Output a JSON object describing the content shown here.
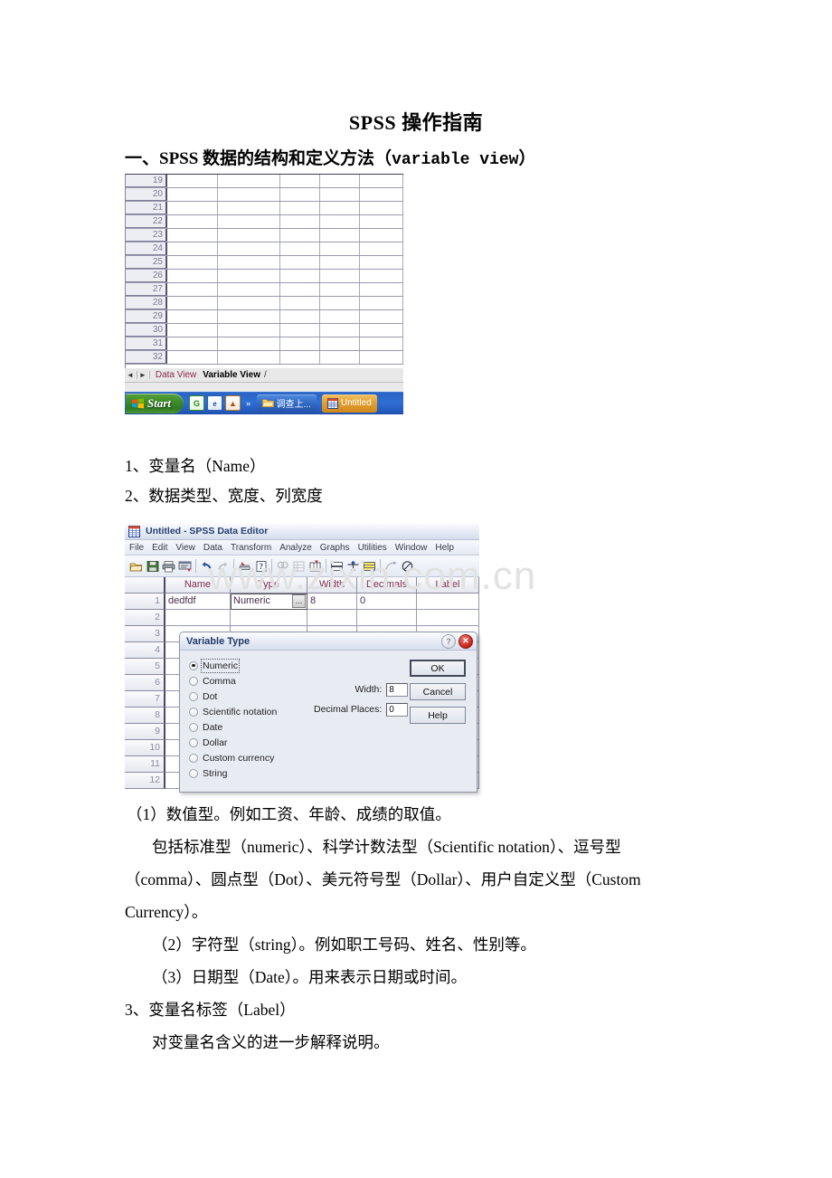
{
  "document": {
    "title": "SPSS 操作指南",
    "heading1_prefix": "一、SPSS 数据的结构和定义方法（",
    "heading1_mono": "variable view",
    "heading1_suffix": "）",
    "item1": "1、变量名（Name）",
    "item2": "2、数据类型、宽度、列宽度",
    "p1": "（1）数值型。例如工资、年龄、成绩的取值。",
    "p2": "包括标准型（numeric）、科学计数法型（Scientific notation）、逗号型",
    "p3": "（comma）、圆点型（Dot）、美元符号型（Dollar）、用户自定义型（Custom",
    "p4": "Currency）。",
    "p5": "（2）字符型（string）。例如职工号码、姓名、性别等。",
    "p6": "（3）日期型（Date）。用来表示日期或时间。",
    "p7": "3、变量名标签（Label）",
    "p8": "对变量名含义的进一步解释说明。",
    "watermark": "www.zixin.com.cn"
  },
  "screenshot1": {
    "row_numbers": [
      "19",
      "20",
      "21",
      "22",
      "23",
      "24",
      "25",
      "26",
      "27",
      "28",
      "29",
      "30",
      "31",
      "32"
    ],
    "tabs": {
      "back_arrow": "◄",
      "forward_arrow": "►",
      "data_view": "Data View",
      "variable_view": "Variable View",
      "trailing_slash": "/"
    },
    "taskbar": {
      "start_label": "Start",
      "overflow_chevron": "»",
      "items": [
        {
          "label": "调查上...",
          "icon": "folder-icon"
        },
        {
          "label": "Untitled",
          "icon": "spss-icon"
        }
      ],
      "quick_launch": [
        {
          "icon": "green-g-icon",
          "letter": "G"
        },
        {
          "icon": "blue-e-icon",
          "letter": "e"
        },
        {
          "icon": "foxmail-icon",
          "letter": "!"
        }
      ]
    }
  },
  "screenshot2": {
    "window_title": "Untitled - SPSS Data Editor",
    "menus": [
      "File",
      "Edit",
      "View",
      "Data",
      "Transform",
      "Analyze",
      "Graphs",
      "Utilities",
      "Window",
      "Help"
    ],
    "toolbar_icons": [
      "open-file-icon",
      "save-icon",
      "print-icon",
      "dialog-recall-icon",
      "undo-icon",
      "redo-icon",
      "goto-chart-icon",
      "goto-case-icon",
      "variables-icon",
      "find-icon",
      "insert-case-icon",
      "insert-variable-icon",
      "split-file-icon",
      "weight-cases-icon",
      "select-cases-icon",
      "value-labels-icon",
      "use-sets-icon"
    ],
    "columns": [
      "Name",
      "Type",
      "Width",
      "Decimals",
      "Label"
    ],
    "rows": [
      {
        "num": "1",
        "name": "dedfdf",
        "type": "Numeric",
        "width": "8",
        "decimals": "0",
        "label": ""
      },
      {
        "num": "2",
        "name": "",
        "type": "",
        "width": "",
        "decimals": "",
        "label": ""
      },
      {
        "num": "3",
        "name": "",
        "type": "",
        "width": "",
        "decimals": "",
        "label": ""
      },
      {
        "num": "4",
        "name": "",
        "type": "",
        "width": "",
        "decimals": "",
        "label": ""
      },
      {
        "num": "5",
        "name": "",
        "type": "",
        "width": "",
        "decimals": "",
        "label": ""
      },
      {
        "num": "6",
        "name": "",
        "type": "",
        "width": "",
        "decimals": "",
        "label": ""
      },
      {
        "num": "7",
        "name": "",
        "type": "",
        "width": "",
        "decimals": "",
        "label": ""
      },
      {
        "num": "8",
        "name": "",
        "type": "",
        "width": "",
        "decimals": "",
        "label": ""
      },
      {
        "num": "9",
        "name": "",
        "type": "",
        "width": "",
        "decimals": "",
        "label": ""
      },
      {
        "num": "10",
        "name": "",
        "type": "",
        "width": "",
        "decimals": "",
        "label": ""
      },
      {
        "num": "11",
        "name": "",
        "type": "",
        "width": "",
        "decimals": "",
        "label": ""
      },
      {
        "num": "12",
        "name": "",
        "type": "",
        "width": "",
        "decimals": "",
        "label": ""
      }
    ],
    "type_cell_ellipsis": "..."
  },
  "variable_type_dialog": {
    "title": "Variable Type",
    "help_glyph": "?",
    "close_glyph": "✕",
    "options": [
      {
        "label": "Numeric",
        "selected": true
      },
      {
        "label": "Comma",
        "selected": false
      },
      {
        "label": "Dot",
        "selected": false
      },
      {
        "label": "Scientific notation",
        "selected": false
      },
      {
        "label": "Date",
        "selected": false
      },
      {
        "label": "Dollar",
        "selected": false
      },
      {
        "label": "Custom currency",
        "selected": false
      },
      {
        "label": "String",
        "selected": false
      }
    ],
    "width_label": "Width:",
    "width_value": "8",
    "decimals_label": "Decimal Places:",
    "decimals_value": "0",
    "buttons": [
      {
        "label": "OK",
        "default": true
      },
      {
        "label": "Cancel",
        "default": false
      },
      {
        "label": "Help",
        "default": false
      }
    ]
  },
  "colors": {
    "title_bar_text": "#25406e",
    "column_header_text": "#7b2d4e",
    "cell_text": "#4a2b4a",
    "watermark": "#e2e2e2",
    "taskbar_blue": "#2f6fd4",
    "start_green": "#3f8c2c"
  }
}
